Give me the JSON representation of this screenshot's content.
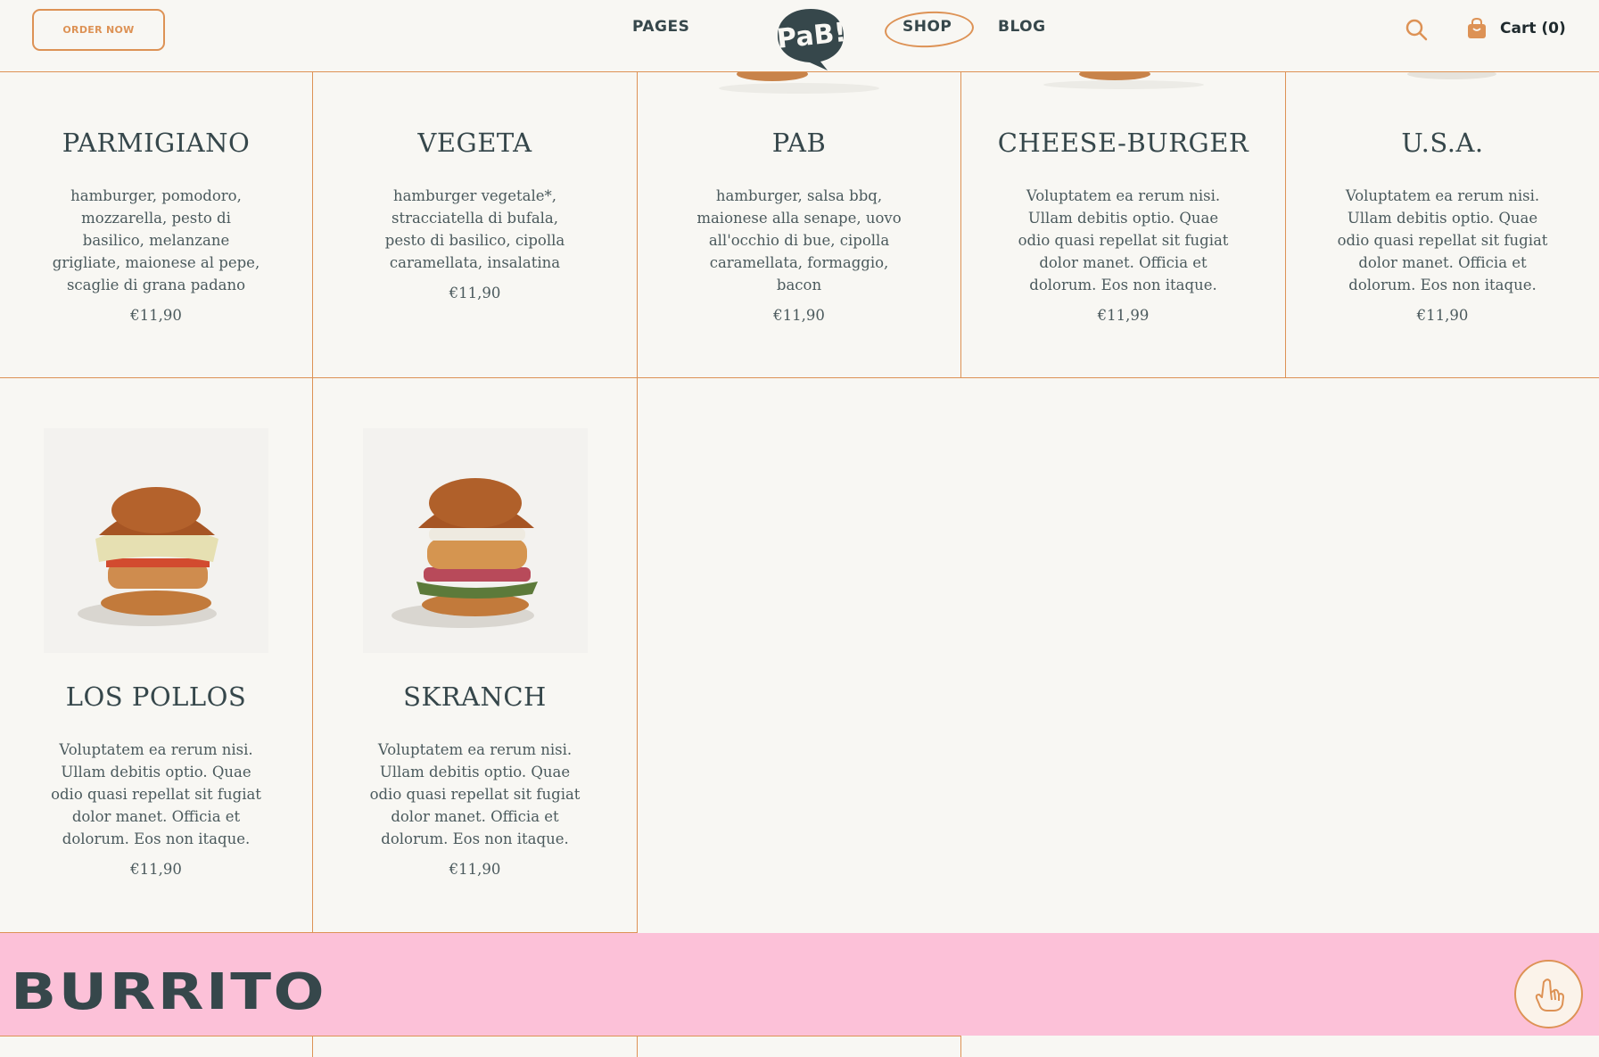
{
  "header": {
    "order_button": "ORDER NOW",
    "nav": {
      "pages": "PAGES",
      "shop": "SHOP",
      "blog": "BLOG"
    },
    "logo_text": "PaB!",
    "cart_label": "Cart (0)"
  },
  "products": [
    {
      "title": "PARMIGIANO",
      "desc": "hamburger, pomodoro, mozzarella, pesto di basilico, melanzane grigliate, maionese al pepe, scaglie di grana padano",
      "price": "€11,90"
    },
    {
      "title": "VEGETA",
      "desc": "hamburger vegetale*, stracciatella di bufala, pesto di basilico, cipolla caramellata, insalatina",
      "price": "€11,90"
    },
    {
      "title": "PAB",
      "desc": "hamburger, salsa bbq, maionese alla senape, uovo all'occhio di bue, cipolla caramellata, formaggio, bacon",
      "price": "€11,90"
    },
    {
      "title": "CHEESE-BURGER",
      "desc": "Voluptatem ea rerum nisi. Ullam debitis optio. Quae odio quasi repellat sit fugiat dolor manet. Officia et dolorum. Eos non itaque.",
      "price": "€11,99"
    },
    {
      "title": "U.S.A.",
      "desc": "Voluptatem ea rerum nisi. Ullam debitis optio. Quae odio quasi repellat sit fugiat dolor manet. Officia et dolorum. Eos non itaque.",
      "price": "€11,90"
    },
    {
      "title": "LOS POLLOS",
      "desc": "Voluptatem ea rerum nisi. Ullam debitis optio. Quae odio quasi repellat sit fugiat dolor manet. Officia et dolorum. Eos non itaque.",
      "price": "€11,90"
    },
    {
      "title": "SKRANCH",
      "desc": "Voluptatem ea rerum nisi. Ullam debitis optio. Quae odio quasi repellat sit fugiat dolor manet. Officia et dolorum. Eos non itaque.",
      "price": "€11,90"
    }
  ],
  "banner": {
    "title": "BURRITO"
  },
  "colors": {
    "accent": "#dd9255",
    "dark": "#36474b",
    "banner": "#fcc1d8",
    "background": "#f8f7f3"
  },
  "icons": [
    "search-icon",
    "shopping-bag-icon",
    "hand-pointer-icon"
  ]
}
